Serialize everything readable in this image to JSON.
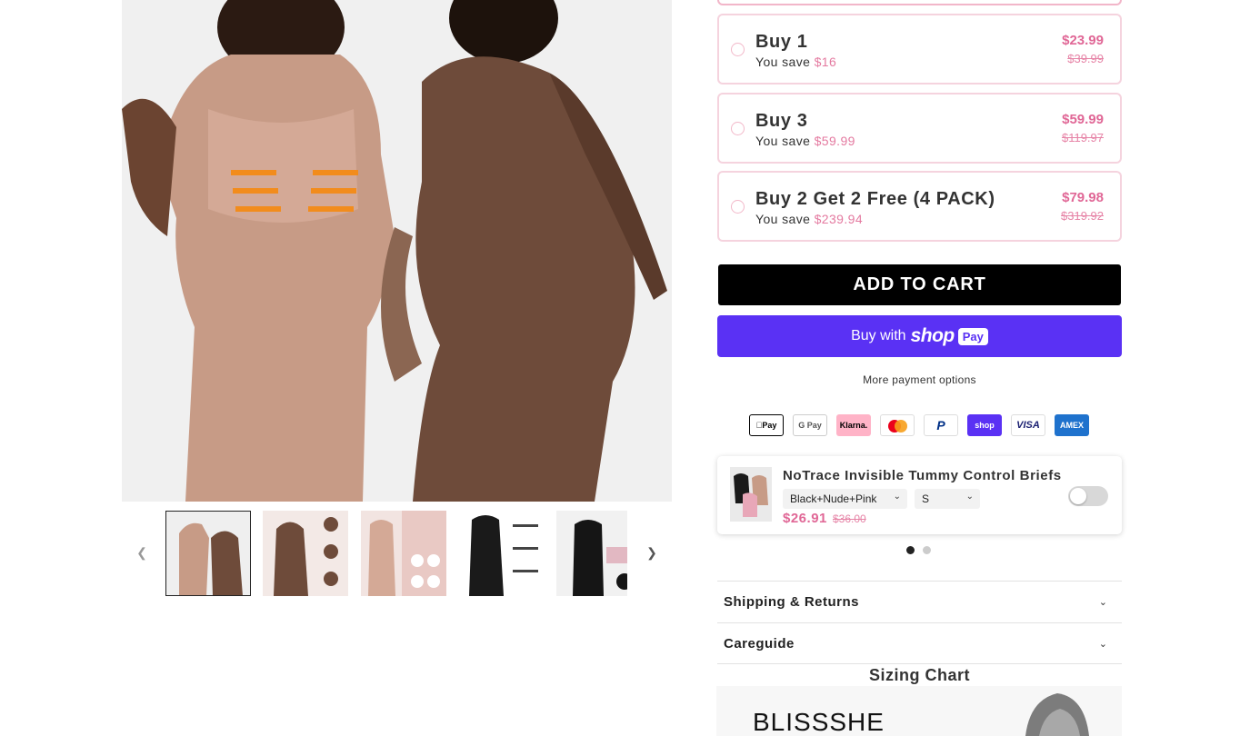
{
  "gallery": {
    "main_alt": "Shapewear bodysuit shorts in nude and brown",
    "thumbnails": [
      {
        "name": "thumb-1",
        "active": true
      },
      {
        "name": "thumb-2",
        "active": false
      },
      {
        "name": "thumb-3",
        "active": false
      },
      {
        "name": "thumb-4",
        "active": false
      },
      {
        "name": "thumb-5",
        "active": false
      }
    ],
    "prev_icon": "chevron-left-icon",
    "next_icon": "chevron-right-icon"
  },
  "offers": [
    {
      "title": "Buy 1",
      "save_label": "You save",
      "save_amount": "$16",
      "price": "$23.99",
      "old_price": "$39.99"
    },
    {
      "title": "Buy 3",
      "save_label": "You save",
      "save_amount": "$59.99",
      "price": "$59.99",
      "old_price": "$119.97"
    },
    {
      "title": "Buy 2 Get 2 Free  (4 PACK)",
      "save_label": "You save",
      "save_amount": "$239.94",
      "price": "$79.98",
      "old_price": "$319.92"
    }
  ],
  "buttons": {
    "add_to_cart": "ADD TO CART",
    "buy_with": "Buy with",
    "shop_logo": "shop",
    "pay_pill": "Pay",
    "more_options": "More payment options"
  },
  "payment_icons": [
    "Pay",
    "G Pay",
    "Klarna.",
    "",
    "P",
    "shop",
    "VISA",
    "AMEX"
  ],
  "upsell": {
    "name": "NoTrace Invisible Tummy Control Briefs",
    "color": "Black+Nude+Pink",
    "size": "S",
    "price": "$26.91",
    "old_price": "$36.00",
    "toggle_on": false
  },
  "accordions": [
    {
      "label": "Shipping & Returns"
    },
    {
      "label": "Careguide"
    }
  ],
  "sizing": {
    "title": "Sizing Chart",
    "brand": "BLISSSHE"
  },
  "colors": {
    "accent_pink": "#e06796",
    "offer_border": "#f5d3de",
    "shop_pay": "#5a31f4"
  }
}
